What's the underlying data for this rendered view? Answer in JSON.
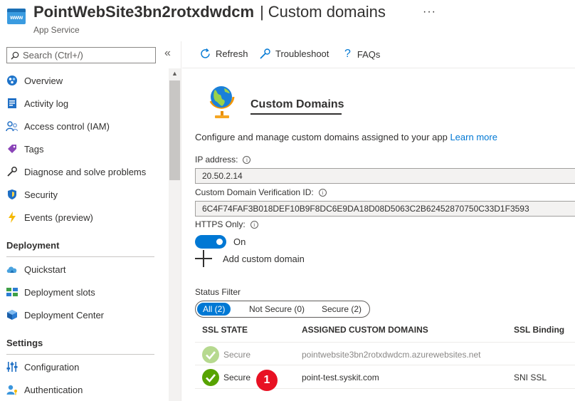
{
  "header": {
    "app_name": "PointWebSite3bn2rotxdwdcm",
    "separator": "|",
    "page_name": "Custom domains",
    "subtitle": "App Service",
    "logo_text": "www",
    "more_label": "···",
    "logo_color": "#3a9be0"
  },
  "sidebar": {
    "search_placeholder": "Search (Ctrl+/)",
    "collapse_label": "«",
    "items": [
      {
        "label": "Overview",
        "icon": "overview-icon"
      },
      {
        "label": "Activity log",
        "icon": "activity-log-icon"
      },
      {
        "label": "Access control (IAM)",
        "icon": "iam-icon"
      },
      {
        "label": "Tags",
        "icon": "tag-icon"
      },
      {
        "label": "Diagnose and solve problems",
        "icon": "wrench-icon"
      },
      {
        "label": "Security",
        "icon": "shield-icon"
      },
      {
        "label": "Events (preview)",
        "icon": "lightning-icon"
      }
    ],
    "sections": [
      {
        "title": "Deployment",
        "items": [
          {
            "label": "Quickstart",
            "icon": "cloud-icon"
          },
          {
            "label": "Deployment slots",
            "icon": "slots-icon"
          },
          {
            "label": "Deployment Center",
            "icon": "cube-icon"
          }
        ]
      },
      {
        "title": "Settings",
        "items": [
          {
            "label": "Configuration",
            "icon": "sliders-icon"
          },
          {
            "label": "Authentication",
            "icon": "person-key-icon"
          }
        ]
      }
    ]
  },
  "toolbar": {
    "refresh": "Refresh",
    "troubleshoot": "Troubleshoot",
    "faqs": "FAQs"
  },
  "main": {
    "heading": "Custom Domains",
    "description": "Configure and manage custom domains assigned to your app",
    "learn_more": "Learn more",
    "ip_label": "IP address:",
    "ip_value": "20.50.2.14",
    "verification_label": "Custom Domain Verification ID:",
    "verification_value": "6C4F74FAF3B018DEF10B9F8DC6E9DA18D08D5063C2B62452870750C33D1F3593",
    "https_label": "HTTPS Only:",
    "https_state": "On",
    "add_domain": "Add custom domain",
    "status_filter_label": "Status Filter",
    "filters": [
      "All (2)",
      "Not Secure (0)",
      "Secure (2)"
    ],
    "table": {
      "headers": [
        "SSL STATE",
        "ASSIGNED CUSTOM DOMAINS",
        "SSL Binding"
      ],
      "rows": [
        {
          "state": "Secure",
          "domain": "pointwebsite3bn2rotxdwdcm.azurewebsites.net",
          "binding": ""
        },
        {
          "state": "Secure",
          "domain": "point-test.syskit.com",
          "binding": "SNI SSL"
        }
      ]
    },
    "callout_number": "1",
    "accent_color": "#0078d4",
    "secure_color": "#57a300"
  }
}
